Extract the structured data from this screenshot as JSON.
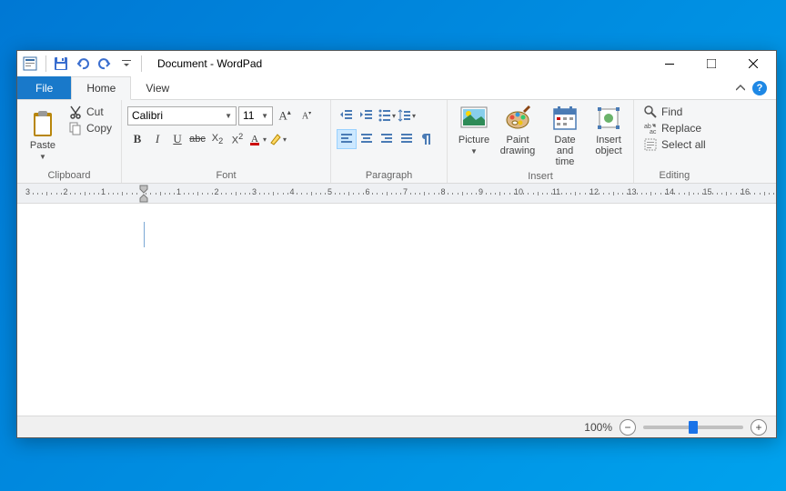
{
  "window": {
    "title": "Document - WordPad"
  },
  "tabs": {
    "file": "File",
    "home": "Home",
    "view": "View"
  },
  "clipboard": {
    "label": "Clipboard",
    "paste": "Paste",
    "cut": "Cut",
    "copy": "Copy"
  },
  "font": {
    "label": "Font",
    "family": "Calibri",
    "size": "11"
  },
  "paragraph": {
    "label": "Paragraph"
  },
  "insert": {
    "label": "Insert",
    "picture": "Picture",
    "paint": "Paint drawing",
    "date": "Date and time",
    "object": "Insert object"
  },
  "editing": {
    "label": "Editing",
    "find": "Find",
    "replace": "Replace",
    "select_all": "Select all"
  },
  "status": {
    "zoom": "100%"
  }
}
